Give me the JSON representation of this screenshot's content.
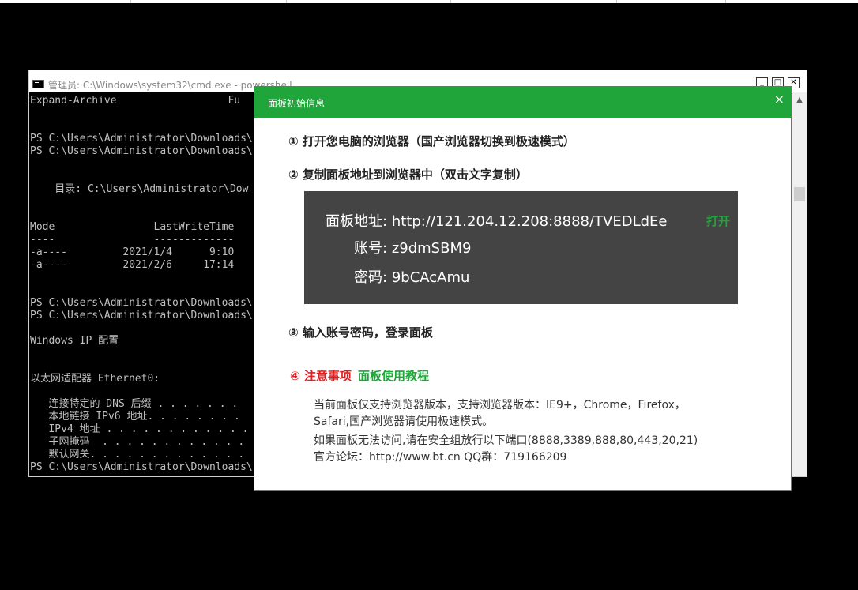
{
  "cmd": {
    "title": "管理员: C:\\Windows\\system32\\cmd.exe - powershell",
    "buttons": {
      "minimize": "_",
      "maximize": "□",
      "close": "✕"
    },
    "lines": [
      "Expand-Archive                  Fu",
      "",
      "",
      "PS C:\\Users\\Administrator\\Downloads\\",
      "PS C:\\Users\\Administrator\\Downloads\\",
      "",
      "",
      "    目录: C:\\Users\\Administrator\\Dow",
      "",
      "",
      "Mode                LastWriteTime",
      "----                -------------",
      "-a----         2021/1/4      9:10",
      "-a----         2021/2/6     17:14",
      "",
      "",
      "PS C:\\Users\\Administrator\\Downloads\\",
      "PS C:\\Users\\Administrator\\Downloads\\",
      "",
      "Windows IP 配置",
      "",
      "",
      "以太网适配器 Ethernet0:",
      "",
      "   连接特定的 DNS 后缀 . . . . . . .",
      "   本地链接 IPv6 地址. . . . . . . .",
      "   IPv4 地址 . . . . . . . . . . . .",
      "   子网掩码  . . . . . . . . . . . .",
      "   默认网关. . . . . . . . . . . . .",
      "PS C:\\Users\\Administrator\\Downloads\\"
    ]
  },
  "dialog": {
    "title": "面板初始信息",
    "close_icon": "×",
    "step1": "① 打开您电脑的浏览器（国产浏览器切换到极速模式）",
    "step2": "② 复制面板地址到浏览器中（双击文字复制）",
    "panel_address_label": "面板地址:",
    "panel_address": "http://121.204.12.208:8888/TVEDLdEe",
    "open_label": "打开",
    "account_label": "账号:",
    "account": "z9dmSBM9",
    "password_label": "密码:",
    "password": "9bCAcAmu",
    "step3": "③ 输入账号密码，登录面板",
    "notice_title": "④ 注意事项",
    "tutorial_link": "面板使用教程",
    "note1a": "当前面板仅支持浏览器版本，支持浏览器版本：IE9+，Chrome，Firefox，",
    "note1b": "Safari,国产浏览器请使用极速模式。",
    "note2": "如果面板无法访问,请在安全组放行以下端口(8888,3389,888,80,443,20,21)",
    "note3": "官方论坛：http://www.bt.cn  QQ群：719166209"
  },
  "colors": {
    "accent": "#20a53a",
    "warning": "#e02020",
    "info_box": "#444444"
  }
}
